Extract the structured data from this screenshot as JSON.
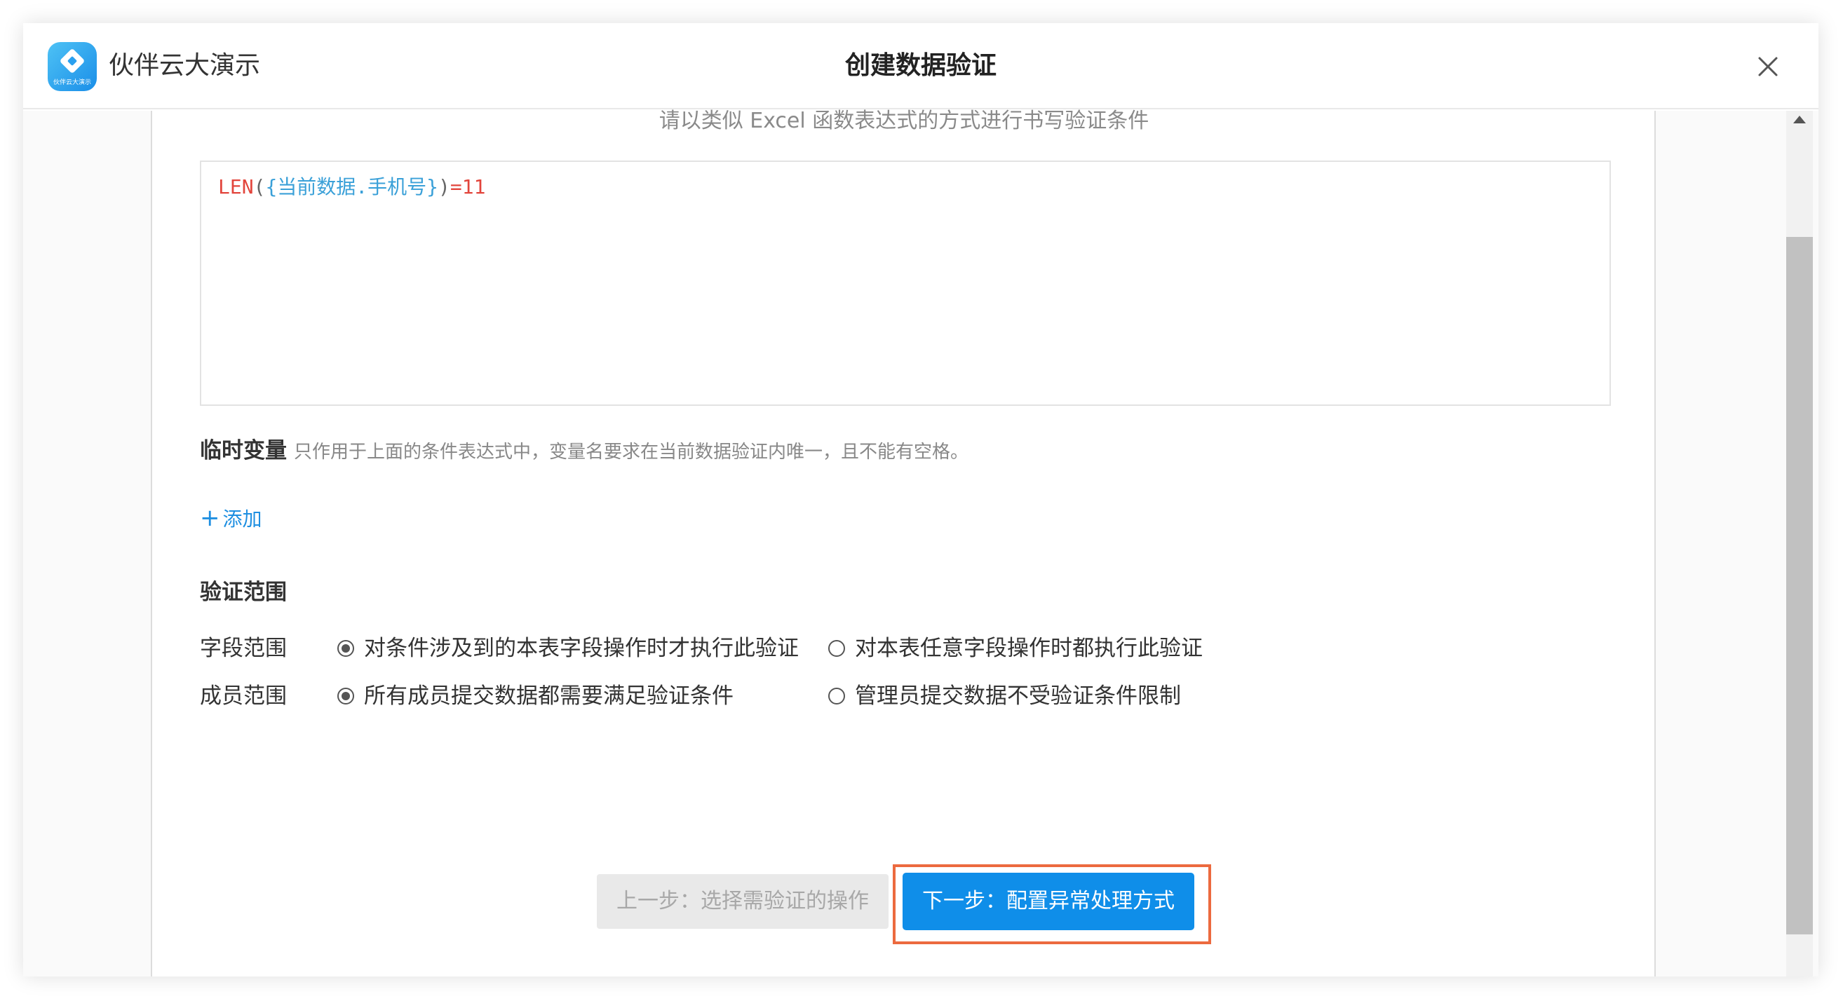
{
  "header": {
    "app_name": "伙伴云大演示",
    "logo_text": "伙伴云大演示",
    "title": "创建数据验证",
    "close_icon": "close-icon"
  },
  "main": {
    "hint": "请以类似 Excel 函数表达式的方式进行书写验证条件",
    "formula": {
      "function": "LEN",
      "open": "(",
      "brace_open": "{",
      "reference": "当前数据.手机号",
      "brace_close": "}",
      "close": ")",
      "operator": "=11"
    },
    "temp_vars": {
      "title": "临时变量",
      "description": "只作用于上面的条件表达式中，变量名要求在当前数据验证内唯一，且不能有空格。",
      "add_label": "添加",
      "add_icon": "plus-icon"
    },
    "scope": {
      "title": "验证范围",
      "field_label": "字段范围",
      "field_options": [
        {
          "label": "对条件涉及到的本表字段操作时才执行此验证",
          "selected": true
        },
        {
          "label": "对本表任意字段操作时都执行此验证",
          "selected": false
        }
      ],
      "member_label": "成员范围",
      "member_options": [
        {
          "label": "所有成员提交数据都需要满足验证条件",
          "selected": true
        },
        {
          "label": "管理员提交数据不受验证条件限制",
          "selected": false
        }
      ]
    }
  },
  "footer": {
    "prev_label": "上一步：选择需验证的操作",
    "next_label": "下一步：配置异常处理方式"
  },
  "colors": {
    "accent": "#0f8ee9",
    "highlight": "#ec6a3f",
    "formula_function": "#e2453c",
    "formula_reference": "#3aa0d8"
  }
}
